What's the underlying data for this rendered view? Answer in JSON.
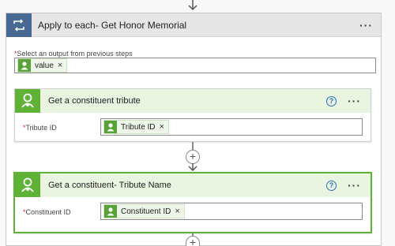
{
  "apply_each": {
    "title": "Apply to each- Get Honor Memorial",
    "more": "···",
    "select_label": "Select an output from previous steps",
    "required_mark": "*",
    "token_label": "value",
    "token_remove": "×"
  },
  "actions": [
    {
      "title": "Get a constituent tribute",
      "help": "?",
      "more": "···",
      "field_label": "Tribute ID",
      "required_mark": "*",
      "token_label": "Tribute ID",
      "token_remove": "×"
    },
    {
      "title": "Get a constituent- Tribute Name",
      "help": "?",
      "more": "···",
      "field_label": "Constituent ID",
      "required_mark": "*",
      "token_label": "Constituent ID",
      "token_remove": "×"
    }
  ],
  "add_step": "+",
  "colors": {
    "loop_tile": "#486991",
    "action_green": "#57a337",
    "selected_border": "#5fb236",
    "help_blue": "#2a6ebb"
  },
  "icons": {
    "loop": "loop-icon",
    "constituent": "constituent-avatar-icon",
    "help": "help-circle-icon",
    "add": "plus-icon",
    "arrow": "arrow-down-icon"
  }
}
